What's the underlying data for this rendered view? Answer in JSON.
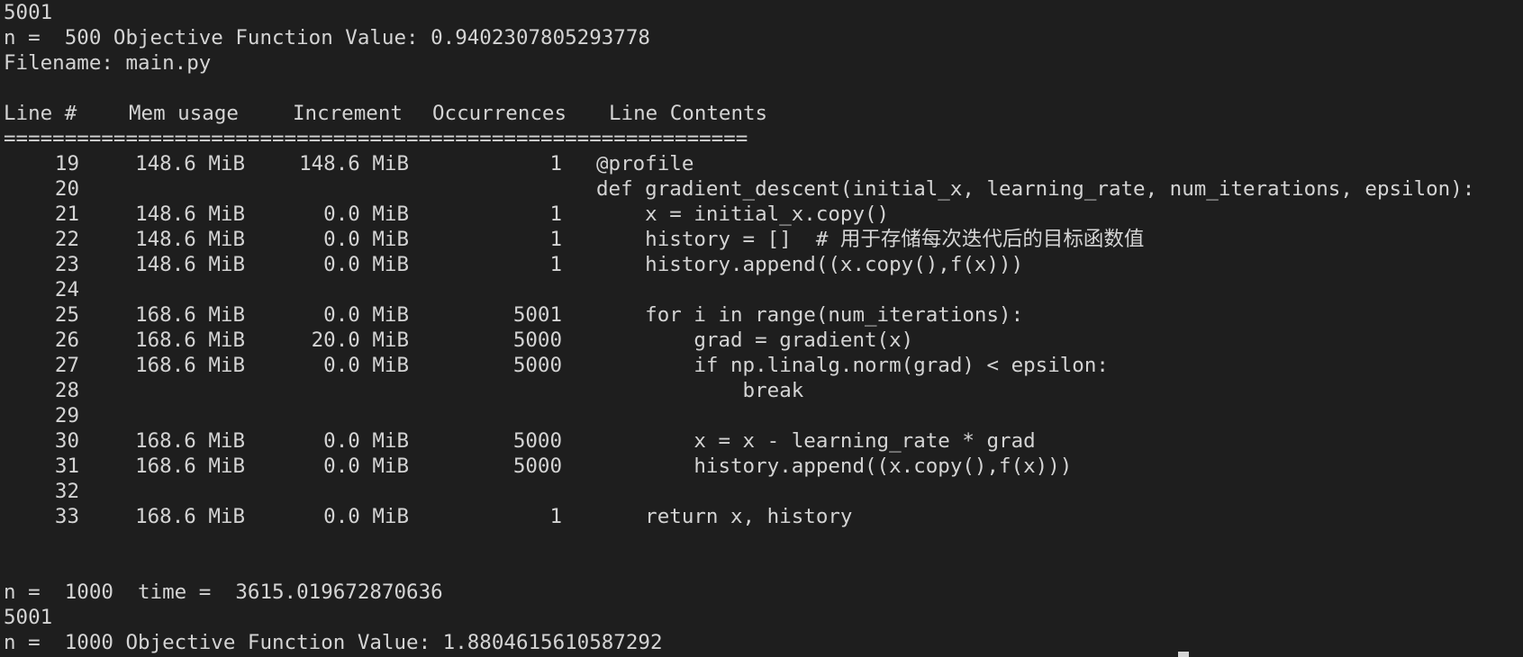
{
  "terminal": {
    "top_lines": [
      "5001",
      "n =  500 Objective Function Value: 0.9402307805293778",
      "Filename: main.py",
      ""
    ],
    "header": {
      "line": "Line #",
      "mem": "Mem usage",
      "inc": "Increment",
      "occ": "Occurrences",
      "contents": "Line Contents"
    },
    "separator": "=============================================================",
    "rows": [
      {
        "line": "19",
        "mem": "148.6 MiB",
        "inc": "148.6 MiB",
        "occ": "1",
        "code": "@profile"
      },
      {
        "line": "20",
        "mem": "",
        "inc": "",
        "occ": "",
        "code": "def gradient_descent(initial_x, learning_rate, num_iterations, epsilon):"
      },
      {
        "line": "21",
        "mem": "148.6 MiB",
        "inc": "0.0 MiB",
        "occ": "1",
        "code": "    x = initial_x.copy()"
      },
      {
        "line": "22",
        "mem": "148.6 MiB",
        "inc": "0.0 MiB",
        "occ": "1",
        "code": "    history = []  # 用于存储每次迭代后的目标函数值"
      },
      {
        "line": "23",
        "mem": "148.6 MiB",
        "inc": "0.0 MiB",
        "occ": "1",
        "code": "    history.append((x.copy(),f(x)))"
      },
      {
        "line": "24",
        "mem": "",
        "inc": "",
        "occ": "",
        "code": ""
      },
      {
        "line": "25",
        "mem": "168.6 MiB",
        "inc": "0.0 MiB",
        "occ": "5001",
        "code": "    for i in range(num_iterations):"
      },
      {
        "line": "26",
        "mem": "168.6 MiB",
        "inc": "20.0 MiB",
        "occ": "5000",
        "code": "        grad = gradient(x)"
      },
      {
        "line": "27",
        "mem": "168.6 MiB",
        "inc": "0.0 MiB",
        "occ": "5000",
        "code": "        if np.linalg.norm(grad) < epsilon:"
      },
      {
        "line": "28",
        "mem": "",
        "inc": "",
        "occ": "",
        "code": "            break"
      },
      {
        "line": "29",
        "mem": "",
        "inc": "",
        "occ": "",
        "code": ""
      },
      {
        "line": "30",
        "mem": "168.6 MiB",
        "inc": "0.0 MiB",
        "occ": "5000",
        "code": "        x = x - learning_rate * grad"
      },
      {
        "line": "31",
        "mem": "168.6 MiB",
        "inc": "0.0 MiB",
        "occ": "5000",
        "code": "        history.append((x.copy(),f(x)))"
      },
      {
        "line": "32",
        "mem": "",
        "inc": "",
        "occ": "",
        "code": ""
      },
      {
        "line": "33",
        "mem": "168.6 MiB",
        "inc": "0.0 MiB",
        "occ": "1",
        "code": "    return x, history"
      }
    ],
    "bottom_lines": [
      "",
      "",
      "n =  1000  time =  3615.019672870636",
      "5001",
      "n =  1000 Objective Function Value: 1.8804615610587292"
    ]
  }
}
